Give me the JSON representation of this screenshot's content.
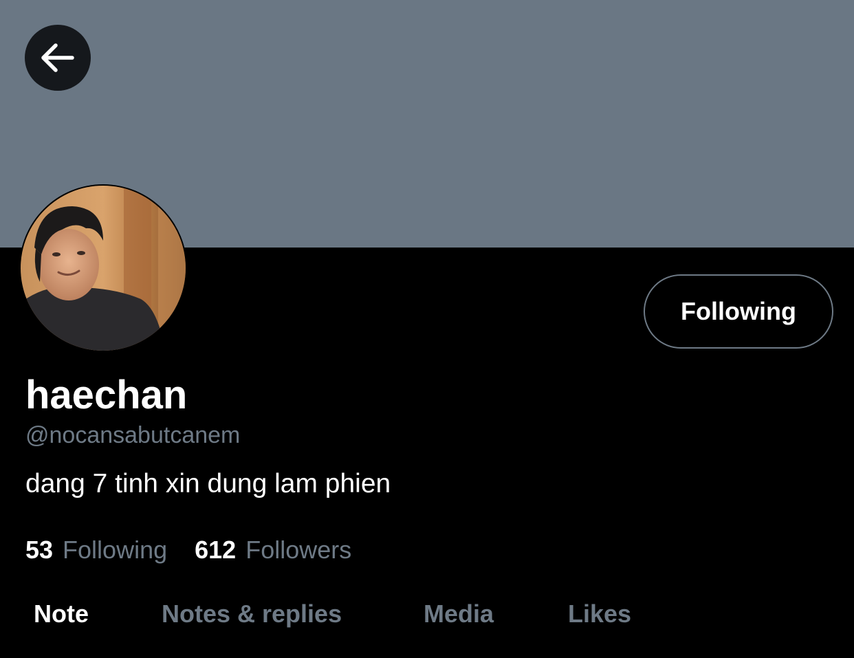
{
  "header": {
    "back_icon": "arrow-left-icon",
    "banner_color": "#6a7784"
  },
  "profile": {
    "display_name": "haechan",
    "handle": "@nocansabutcanem",
    "bio": "dang 7 tinh xin dung lam phien",
    "follow_button_label": "Following",
    "stats": {
      "following_count": "53",
      "following_label": "Following",
      "followers_count": "612",
      "followers_label": "Followers"
    }
  },
  "tabs": [
    {
      "label": "Note",
      "active": true
    },
    {
      "label": "Notes & replies",
      "active": false
    },
    {
      "label": "Media",
      "active": false
    },
    {
      "label": "Likes",
      "active": false
    }
  ],
  "colors": {
    "background": "#000000",
    "secondary_text": "#6e7a86",
    "primary_text": "#ffffff"
  }
}
